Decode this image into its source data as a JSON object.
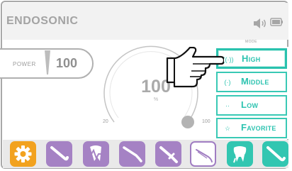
{
  "header": {
    "title": "ENDOSONIC",
    "sound_icon": "speaker-icon",
    "battery_icon": "battery-icon"
  },
  "power": {
    "label": "POWER",
    "value": "100"
  },
  "dial": {
    "value": "100",
    "unit": "%",
    "min_label": "20",
    "max_label": "100",
    "level_percent": 100
  },
  "mode": {
    "label": "MODE",
    "selected": "High",
    "options": [
      {
        "label": "High",
        "icon": "signal-strong-icon",
        "glyph": "((·))"
      },
      {
        "label": "Middle",
        "icon": "signal-medium-icon",
        "glyph": "(·)"
      },
      {
        "label": "Low",
        "icon": "signal-low-icon",
        "glyph": "··"
      },
      {
        "label": "Favorite",
        "icon": "star-icon",
        "glyph": "☆"
      }
    ]
  },
  "toolbar": {
    "items": [
      {
        "icon": "gear-icon",
        "color": "#f2a21f"
      },
      {
        "icon": "scaler-tip-icon",
        "color": "#a582c4"
      },
      {
        "icon": "tooth-pulse-icon",
        "color": "#a582c4"
      },
      {
        "icon": "file-icon",
        "color": "#a582c4"
      },
      {
        "icon": "scaler-tip-icon",
        "color": "#a582c4"
      },
      {
        "icon": "endo-tip-icon",
        "color": "#a582c4",
        "active": true
      },
      {
        "icon": "tooth-icon",
        "color": "#32c6b1"
      },
      {
        "icon": "perio-tip-icon",
        "color": "#32c6b1"
      }
    ]
  },
  "colors": {
    "accent": "#2dc3b0",
    "purple": "#a582c4",
    "orange": "#f2a21f",
    "header_bg": "#f2f2f2",
    "gray_text": "#a3a3a3"
  }
}
